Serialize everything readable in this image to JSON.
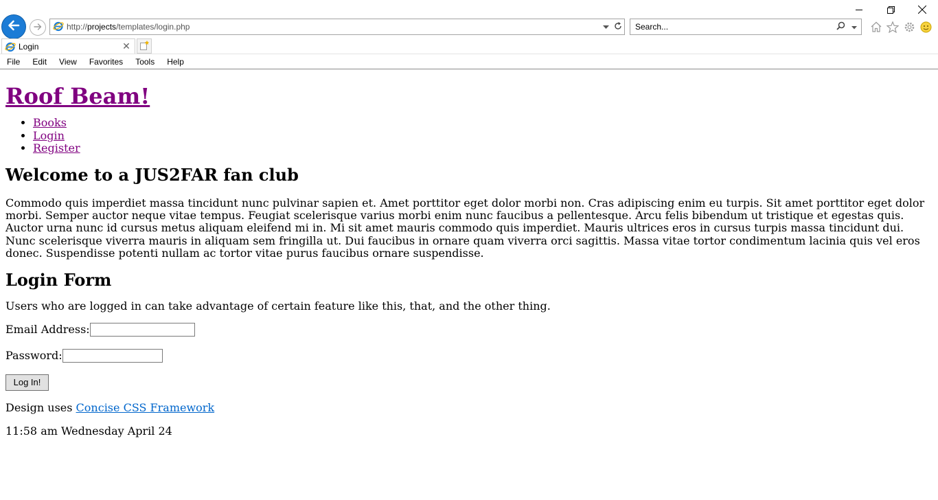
{
  "browser": {
    "address_prefix": "http://",
    "address_host": "projects",
    "address_path": "/templates/login.php",
    "search_placeholder": "Search...",
    "tab_title": "Login",
    "tab_close_glyph": "✕",
    "menu": [
      "File",
      "Edit",
      "View",
      "Favorites",
      "Tools",
      "Help"
    ],
    "icons": [
      "back-arrow-icon",
      "forward-arrow-icon",
      "ie-logo-icon",
      "dropdown-arrow-icon",
      "refresh-icon",
      "search-icon",
      "home-icon",
      "favorites-star-icon",
      "settings-gear-icon",
      "smiley-feedback-icon",
      "new-tab-icon",
      "minimize-icon",
      "restore-icon",
      "close-icon"
    ],
    "accent_color": "#1c7cd6"
  },
  "page": {
    "site_title": "Roof Beam!",
    "nav": [
      "Books",
      "Login",
      "Register"
    ],
    "welcome_heading": "Welcome to a JUS2FAR fan club",
    "lorem": "Commodo quis imperdiet massa tincidunt nunc pulvinar sapien et. Amet porttitor eget dolor morbi non. Cras adipiscing enim eu turpis. Sit amet porttitor eget dolor morbi. Semper auctor neque vitae tempus. Feugiat scelerisque varius morbi enim nunc faucibus a pellentesque. Arcu felis bibendum ut tristique et egestas quis. Auctor urna nunc id cursus metus aliquam eleifend mi in. Mi sit amet mauris commodo quis imperdiet. Mauris ultrices eros in cursus turpis massa tincidunt dui. Nunc scelerisque viverra mauris in aliquam sem fringilla ut. Dui faucibus in ornare quam viverra orci sagittis. Massa vitae tortor condimentum lacinia quis vel eros donec. Suspendisse potenti nullam ac tortor vitae purus faucibus ornare suspendisse.",
    "login_heading": "Login Form",
    "login_intro": "Users who are logged in can take advantage of certain feature like this, that, and the other thing.",
    "email_label": "Email Address:",
    "email_value": "",
    "password_label": "Password:",
    "password_value": "",
    "login_button": "Log In!",
    "design_prefix": "Design uses ",
    "design_link": "Concise CSS Framework",
    "timestamp": "11:58 am Wednesday April 24",
    "visited_link_color": "#800080",
    "link_color": "#0066cc"
  }
}
